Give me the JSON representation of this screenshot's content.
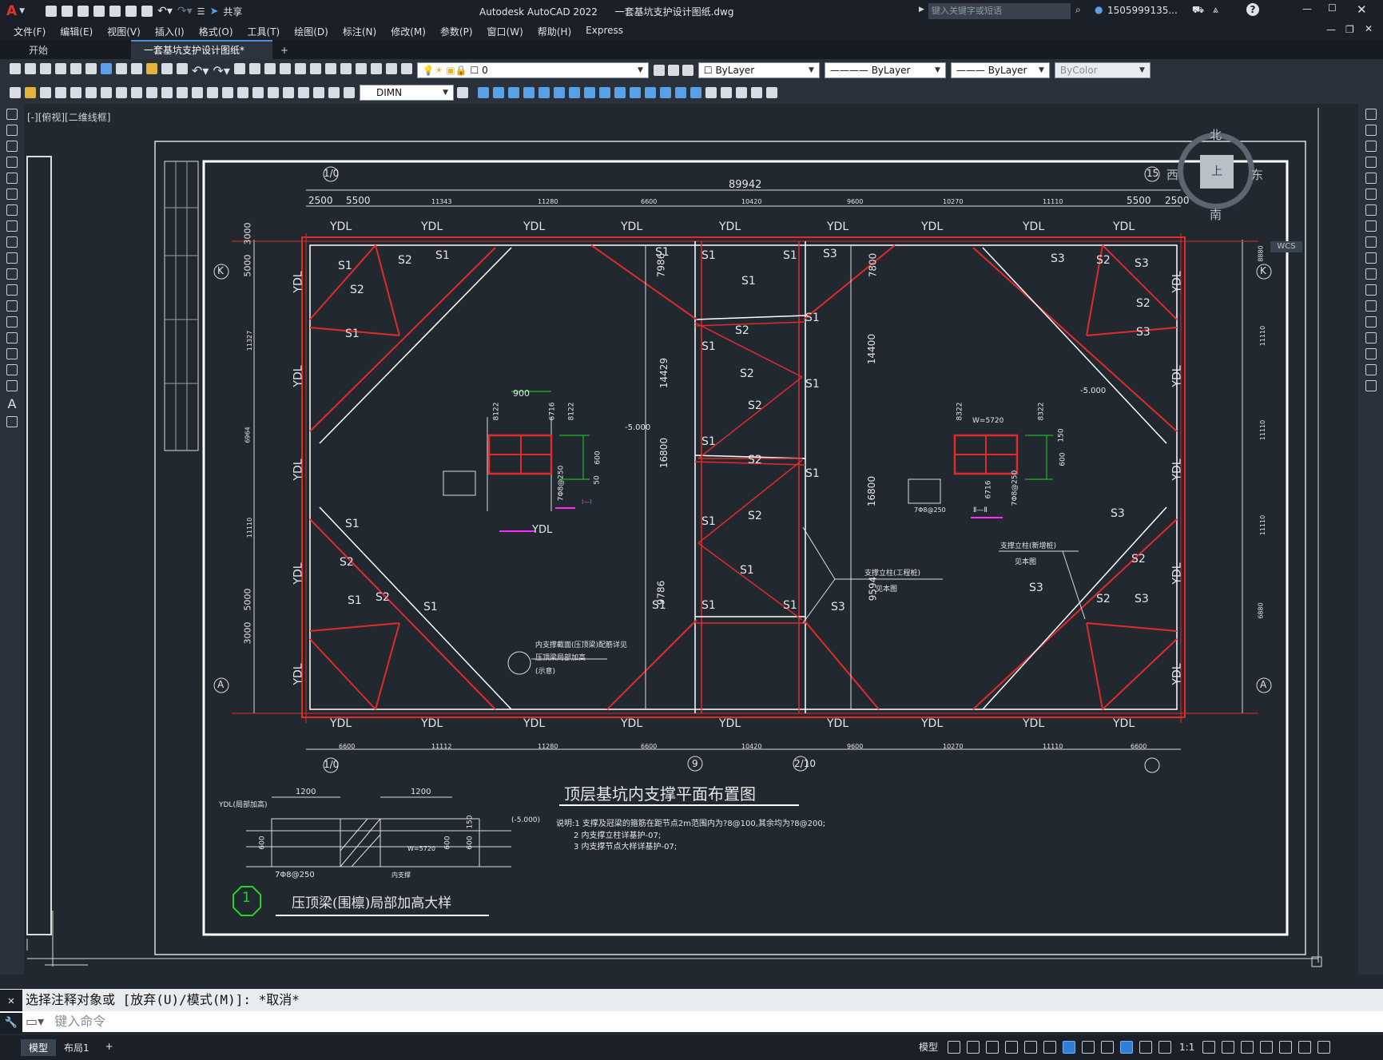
{
  "window": {
    "app_title": "Autodesk AutoCAD 2022",
    "file_name": "一套基坑支护设计图纸.dwg",
    "share_label": "共享",
    "search_placeholder": "键入关键字或短语",
    "user": "1505999135...",
    "help_symbol": "?"
  },
  "menu": [
    "文件(F)",
    "编辑(E)",
    "视图(V)",
    "插入(I)",
    "格式(O)",
    "工具(T)",
    "绘图(D)",
    "标注(N)",
    "修改(M)",
    "参数(P)",
    "窗口(W)",
    "帮助(H)",
    "Express"
  ],
  "tabs": {
    "start": "开始",
    "active_doc": "一套基坑支护设计图纸*",
    "plus": "+"
  },
  "toolbar": {
    "layer_value": "0",
    "color_value": "ByLayer",
    "linetype_value": "ByLayer",
    "lineweight_value": "ByLayer",
    "plotstyle_value": "ByColor",
    "dimstyle_value": "DIMN"
  },
  "viewport": {
    "label": "[-][俯视][二维线框]",
    "compass_north": "北",
    "compass_south": "南",
    "compass_east": "东",
    "compass_west": "西",
    "compass_top": "上",
    "ucs": "WCS"
  },
  "drawing": {
    "overall_dim": "89942",
    "top_dims": [
      "2500",
      "5500",
      "11343",
      "11280",
      "6600",
      "10420",
      "9600",
      "10270",
      "11110",
      "5500",
      "2500"
    ],
    "bottom_dims": [
      "6600",
      "11112",
      "11280",
      "6600",
      "10420",
      "9600",
      "10270",
      "11110",
      "6600"
    ],
    "left_dims": [
      "3000",
      "5000",
      "11327",
      "6964",
      "11110",
      "5000",
      "3000"
    ],
    "right_dims": [
      "8880",
      "11110",
      "11110",
      "11110",
      "6880"
    ],
    "inner_dims": [
      "7986",
      "14429",
      "16800",
      "9786",
      "7800",
      "14400",
      "16800",
      "9594"
    ],
    "axis_top_left": "1/0",
    "axis_top_right": "15",
    "axis_left_k": "K",
    "axis_left_a": "A",
    "axis_bottom": [
      "1/0",
      "9",
      "2/10"
    ],
    "ydl_label": "YDL",
    "strut_labels": {
      "s1": "S1",
      "s2": "S2",
      "s3": "S3"
    },
    "detail_left": {
      "width": "900",
      "h1": "8122",
      "h2": "6716",
      "h3": "8122",
      "depth": "600",
      "cap": "50",
      "elev": "-5.000",
      "rebar": "7Φ8@250",
      "tag": "YDL",
      "section": "Ⅰ—Ⅰ"
    },
    "detail_right": {
      "rebar_top": "W=5720",
      "h1": "8322",
      "h2": "8322",
      "depth": "600",
      "cap": "150",
      "elev": "-5.000",
      "rebar": "7Φ8@250",
      "section": "Ⅱ—Ⅱ",
      "inner": "6716"
    },
    "callout_left": "内支撑截面(压顶梁)配筋详见",
    "callout_left_2": "压顶梁局部加高",
    "callout_left_3": "(示意)",
    "callout_mid_1": "支撑立柱(工程桩)",
    "callout_mid_2": "见本图",
    "callout_right_1": "支撑立柱(新增桩)",
    "callout_right_2": "见本图",
    "title": "顶层基坑内支撑平面布置图",
    "notes": [
      "说明:1 支撑及冠梁的箍筋在距节点2m范围内为?8@100,其余均为?8@200;",
      "2 内支撑立柱详基护-07;",
      "3 内支撑节点大样详基护-07;"
    ],
    "detail2": {
      "label": "YDL(局部加高)",
      "w1": "1200",
      "w2": "1200",
      "h600a": "600",
      "h600b": "600",
      "h600c": "600",
      "h150": "150",
      "elev": "(-5.000)",
      "rebar": "7Φ8@250",
      "inner": "W=5720",
      "inner_label": "内支撑",
      "title": "压顶梁(围檩)局部加高大样",
      "number": "1"
    }
  },
  "command": {
    "history": "选择注释对象或 [放弃(U)/模式(M)]: *取消*",
    "placeholder": "键入命令"
  },
  "layout_tabs": [
    "模型",
    "布局1",
    "+"
  ],
  "status": {
    "model": "模型",
    "scale": "1:1"
  }
}
